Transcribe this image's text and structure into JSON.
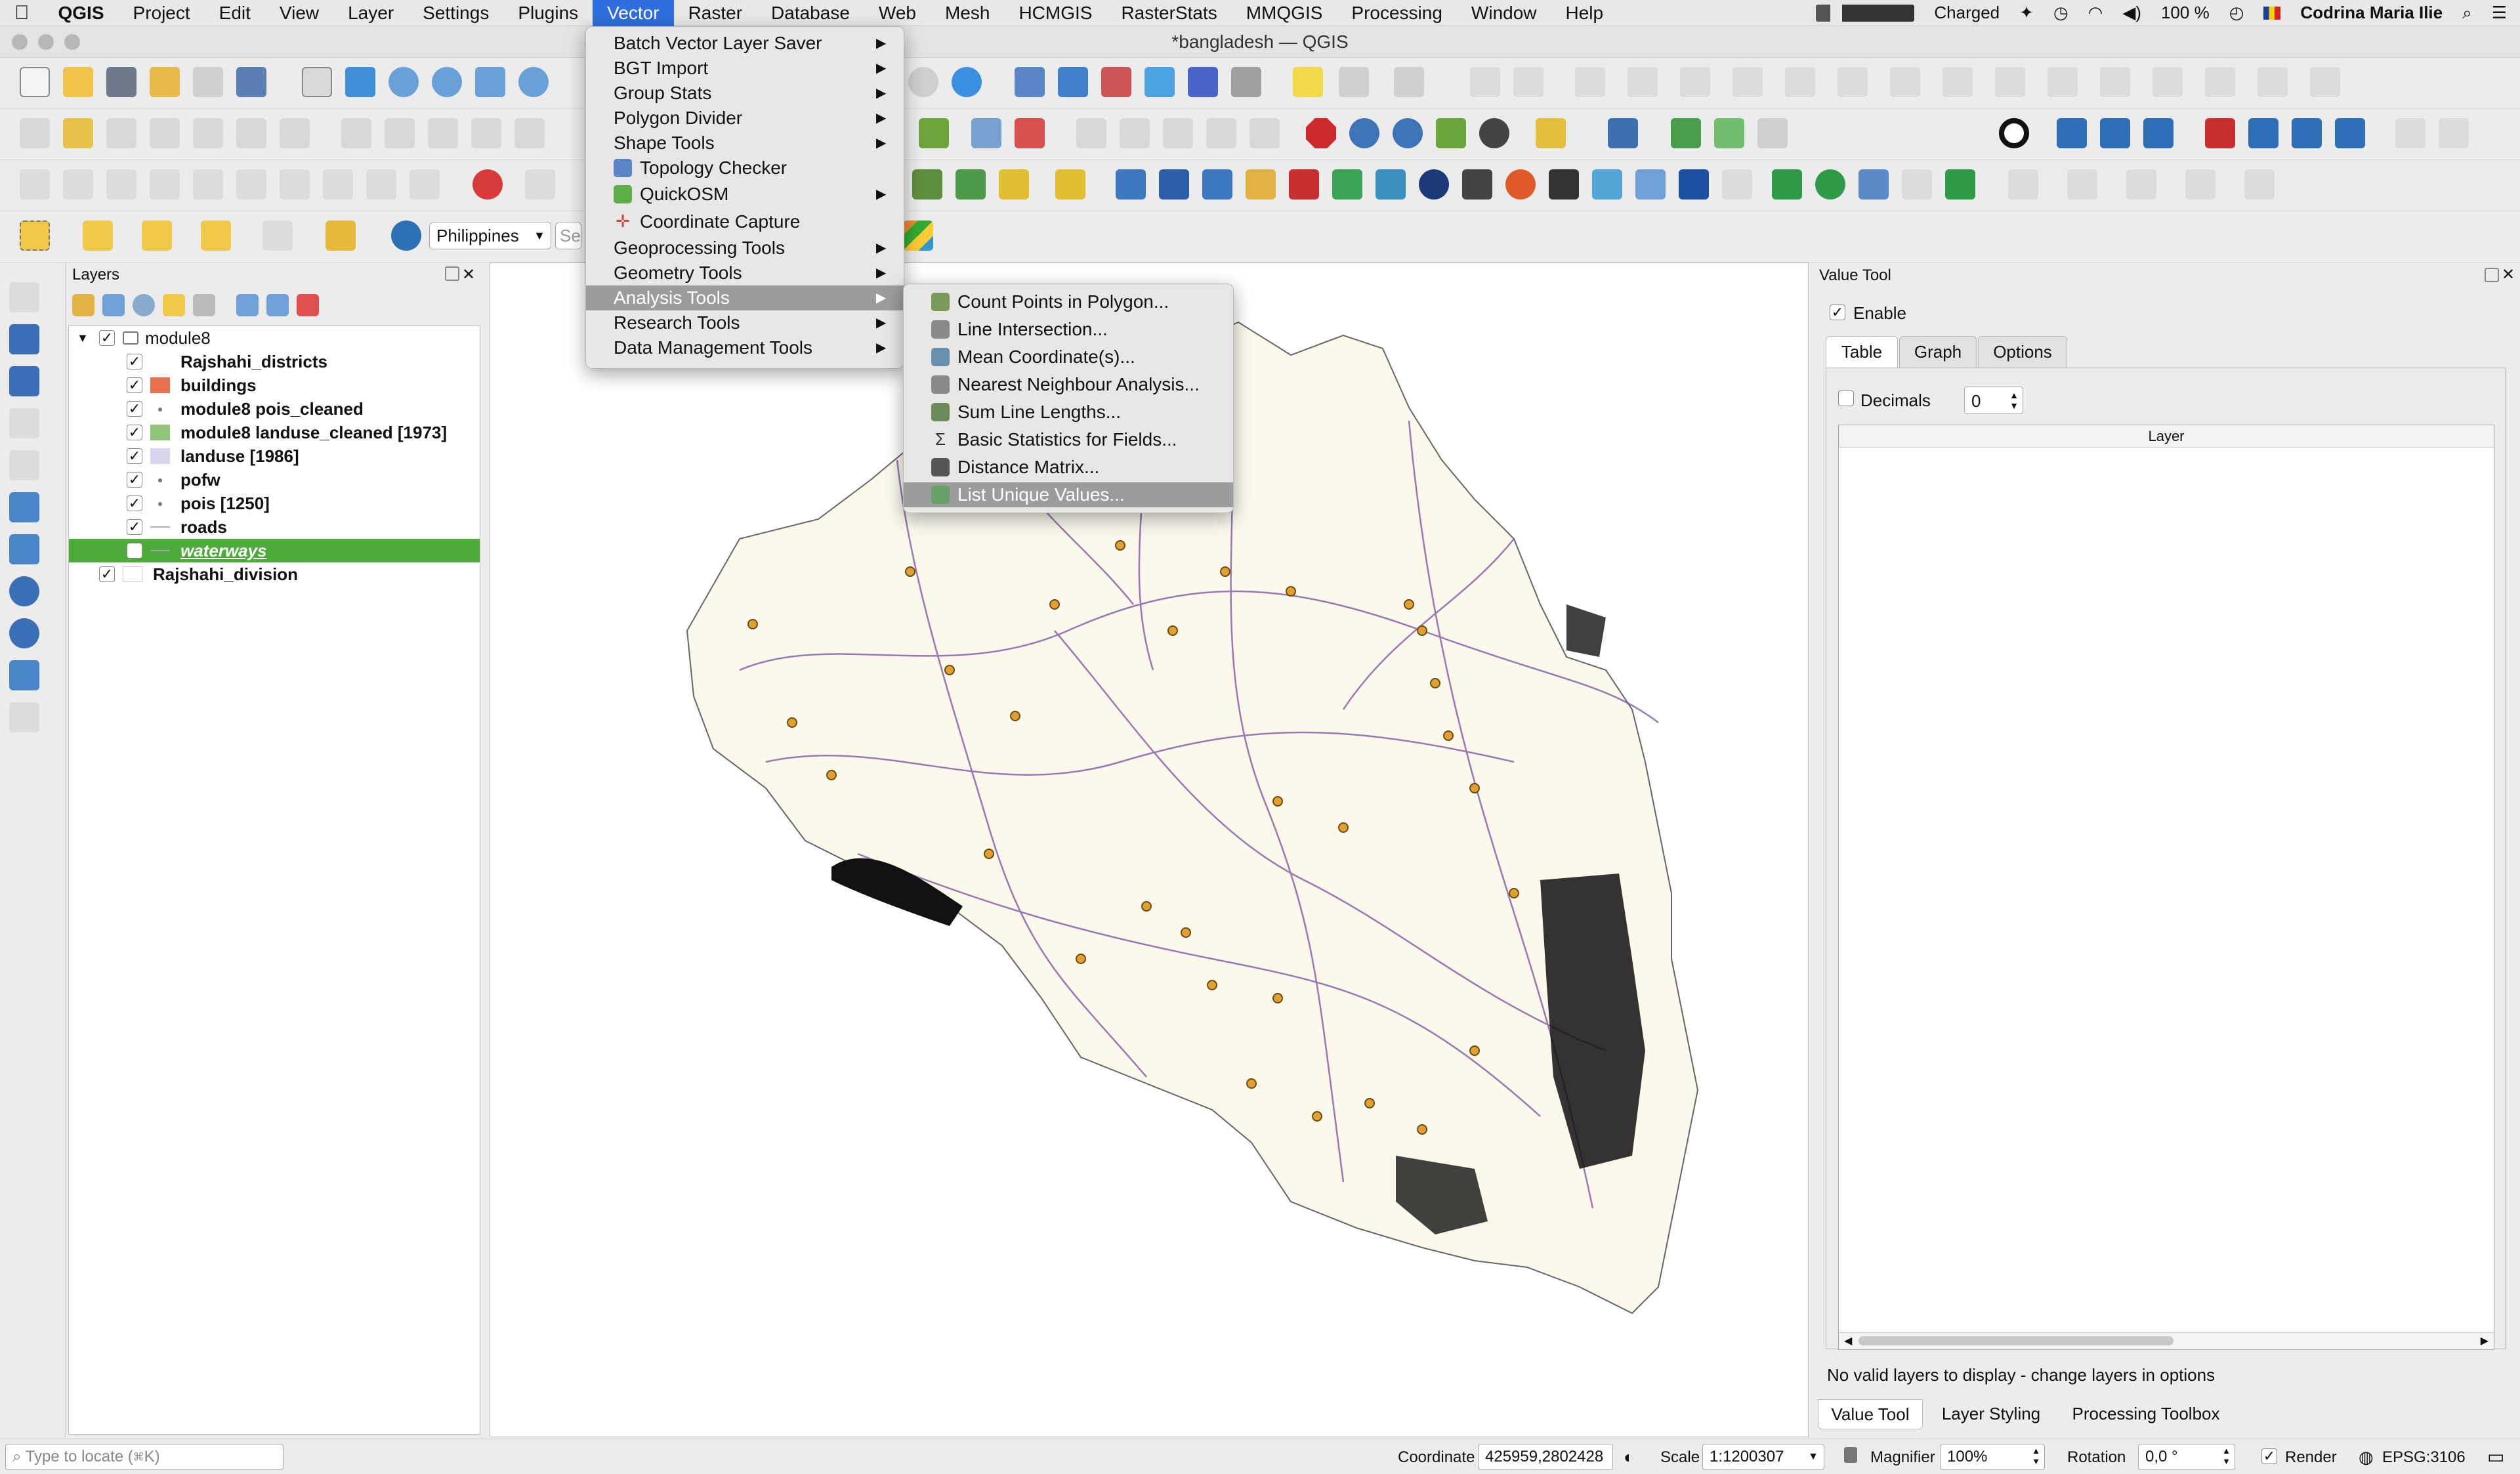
{
  "menubar": {
    "apple": "",
    "items": [
      "QGIS",
      "Project",
      "Edit",
      "View",
      "Layer",
      "Settings",
      "Plugins",
      "Vector",
      "Raster",
      "Database",
      "Web",
      "Mesh",
      "HCMGIS",
      "RasterStats",
      "MMQGIS",
      "Processing",
      "Window",
      "Help"
    ],
    "active": "Vector",
    "battery_status": "Charged",
    "battery_percent": "100 %",
    "user": "Codrina Maria Ilie"
  },
  "window": {
    "title": "*bangladesh — QGIS"
  },
  "toolbar": {
    "locator_combo": "Philippines",
    "search_placeholder": "Sea"
  },
  "layers_panel": {
    "title": "Layers",
    "group": "module8",
    "layers": [
      {
        "name": "Rajshahi_districts",
        "checked": true,
        "swatch": "#ffffff"
      },
      {
        "name": "buildings",
        "checked": true,
        "swatch": "#e8704d"
      },
      {
        "name": "module8 pois_cleaned",
        "checked": true,
        "swatch": "dot"
      },
      {
        "name": "module8 landuse_cleaned [1973]",
        "checked": true,
        "swatch": "#8fc47a"
      },
      {
        "name": "landuse [1986]",
        "checked": true,
        "swatch": "#d8d4f0"
      },
      {
        "name": "pofw",
        "checked": true,
        "swatch": "dot"
      },
      {
        "name": "pois [1250]",
        "checked": true,
        "swatch": "dot"
      },
      {
        "name": "roads",
        "checked": true,
        "swatch": "line"
      },
      {
        "name": "waterways",
        "checked": false,
        "swatch": "line"
      }
    ],
    "top_level": {
      "name": "Rajshahi_division",
      "checked": true
    }
  },
  "vector_menu": {
    "items": [
      {
        "label": "Batch Vector Layer Saver",
        "submenu": true
      },
      {
        "label": "BGT Import",
        "submenu": true
      },
      {
        "label": "Group Stats",
        "submenu": true
      },
      {
        "label": "Polygon Divider",
        "submenu": true
      },
      {
        "label": "Shape Tools",
        "submenu": true
      },
      {
        "label": "Topology Checker",
        "submenu": false
      },
      {
        "label": "QuickOSM",
        "submenu": true
      },
      {
        "label": "Coordinate Capture",
        "submenu": false
      },
      {
        "label": "Geoprocessing Tools",
        "submenu": true
      },
      {
        "label": "Geometry Tools",
        "submenu": true
      },
      {
        "label": "Analysis Tools",
        "submenu": true
      },
      {
        "label": "Research Tools",
        "submenu": true
      },
      {
        "label": "Data Management Tools",
        "submenu": true
      }
    ],
    "highlighted": "Analysis Tools"
  },
  "analysis_submenu": {
    "items": [
      "Count Points in Polygon...",
      "Line Intersection...",
      "Mean Coordinate(s)...",
      "Nearest Neighbour Analysis...",
      "Sum Line Lengths...",
      "Basic Statistics for Fields...",
      "Distance Matrix...",
      "List Unique Values..."
    ],
    "highlighted": "List Unique Values..."
  },
  "value_tool": {
    "title": "Value Tool",
    "enable_label": "Enable",
    "enabled": true,
    "tabs": [
      "Table",
      "Graph",
      "Options"
    ],
    "active_tab": "Table",
    "decimals_label": "Decimals",
    "decimals_value": "0",
    "column_header": "Layer",
    "message": "No valid layers to display - change layers in options"
  },
  "dock_tabs": [
    "Value Tool",
    "Layer Styling",
    "Processing Toolbox"
  ],
  "statusbar": {
    "locate_placeholder": "Type to locate (⌘K)",
    "coordinate_label": "Coordinate",
    "coordinate_value": "425959,2802428",
    "scale_label": "Scale",
    "scale_value": "1:1200307",
    "magnifier_label": "Magnifier",
    "magnifier_value": "100%",
    "rotation_label": "Rotation",
    "rotation_value": "0,0 °",
    "render_label": "Render",
    "crs": "EPSG:3106"
  },
  "colors": {
    "menu_active": "#2f6ede",
    "selection_green": "#4cac39",
    "map_fill": "#fbf9ec",
    "road_purple": "#7a4ca0",
    "poi_orange": "#e0a030"
  }
}
